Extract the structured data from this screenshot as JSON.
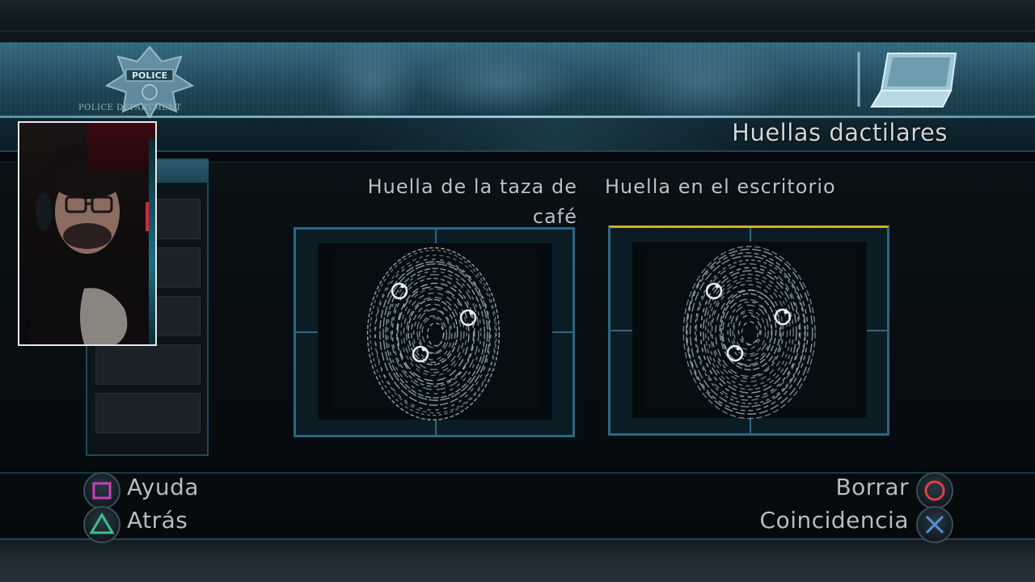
{
  "header": {
    "badge_text": "POLICE",
    "department_label": "POLICE DEPARTMENT",
    "screen_title": "Huellas dactilares",
    "laptop_icon": "laptop-icon"
  },
  "prints": [
    {
      "caption_line1": "Huella de la taza de",
      "caption_line2": "café",
      "selected": false,
      "icon": "fingerprint-icon"
    },
    {
      "caption_line1": "Huella en el escritorio",
      "caption_line2": "",
      "selected": true,
      "icon": "fingerprint-icon"
    }
  ],
  "selection_color": "#d2b221",
  "controls": {
    "help": {
      "label": "Ayuda",
      "button": "square-icon",
      "color": "#c73fb8"
    },
    "back": {
      "label": "Atrás",
      "button": "triangle-icon",
      "color": "#3fbf8a"
    },
    "erase": {
      "label": "Borrar",
      "button": "circle-icon",
      "color": "#e0414a"
    },
    "match": {
      "label": "Coincidencia",
      "button": "cross-icon",
      "color": "#5b8fd9"
    }
  },
  "list_slots": 5
}
